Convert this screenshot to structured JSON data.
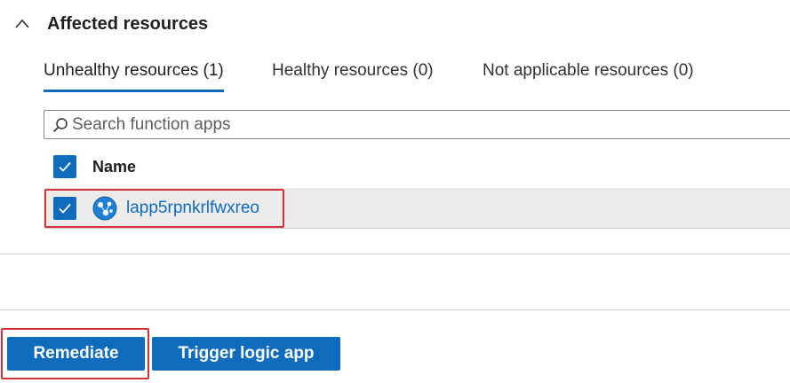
{
  "section": {
    "title": "Affected resources",
    "chevron_icon": "chevron-up-icon"
  },
  "tabs": [
    {
      "label": "Unhealthy resources (1)",
      "active": true
    },
    {
      "label": "Healthy resources (0)",
      "active": false
    },
    {
      "label": "Not applicable resources (0)",
      "active": false
    }
  ],
  "search": {
    "placeholder": "Search function apps",
    "value": "",
    "icon": "search-icon"
  },
  "table": {
    "select_all_checked": true,
    "columns": [
      "Name"
    ],
    "rows": [
      {
        "name": "lapp5rpnkrlfwxreo",
        "checked": true,
        "icon": "function-app-icon",
        "highlighted": true
      }
    ]
  },
  "actions": {
    "remediate_label": "Remediate",
    "trigger_label": "Trigger logic app"
  },
  "colors": {
    "accent": "#0f6cbd",
    "highlight": "#d13438",
    "row_background": "#edebe9"
  }
}
